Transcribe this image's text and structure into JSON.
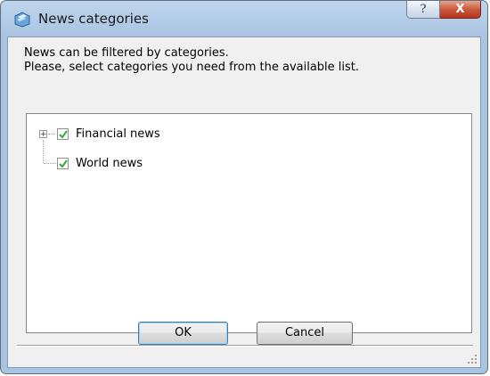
{
  "window": {
    "title": "News categories",
    "help_button": "?",
    "close_button": "X"
  },
  "description": {
    "line1": "News can be filtered by categories.",
    "line2": "Please, select categories you need from the available list."
  },
  "tree": {
    "items": [
      {
        "label": "Financial news",
        "checked": true,
        "expandable": true
      },
      {
        "label": "World news",
        "checked": true,
        "expandable": false
      }
    ],
    "expander_glyph": "+"
  },
  "buttons": {
    "ok": "OK",
    "cancel": "Cancel"
  }
}
